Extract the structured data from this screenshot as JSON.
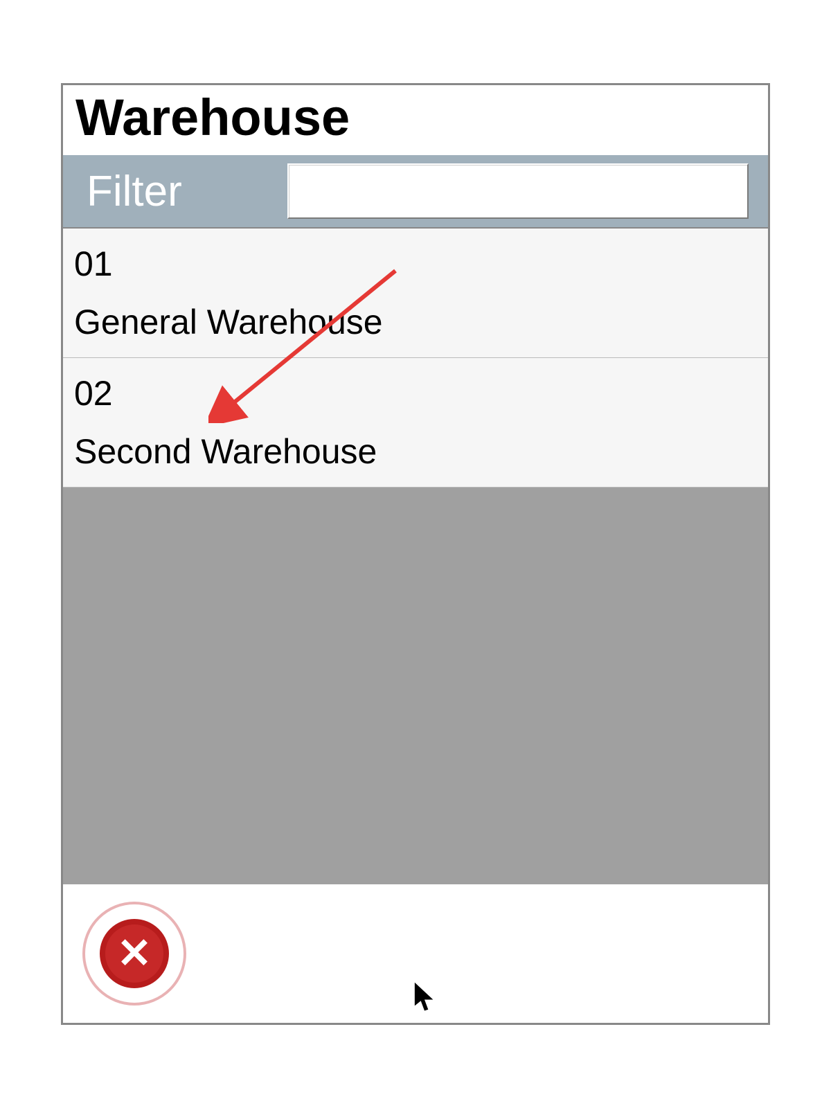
{
  "header": {
    "title": "Warehouse"
  },
  "filter": {
    "label": "Filter",
    "value": ""
  },
  "items": [
    {
      "code": "01",
      "name": "General Warehouse"
    },
    {
      "code": "02",
      "name": "Second  Warehouse"
    }
  ],
  "footer": {
    "close_label": "Close"
  }
}
